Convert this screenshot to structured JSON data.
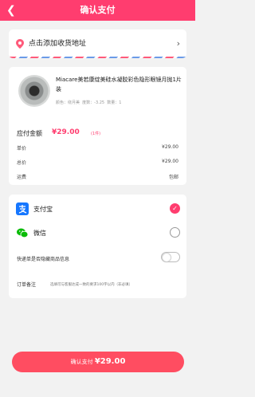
{
  "header": {
    "title": "确认支付",
    "back_glyph": "❮"
  },
  "address": {
    "placeholder_text": "点击添加收货地址",
    "arrow_glyph": "›",
    "pin_color": "#ff5a7a"
  },
  "product": {
    "name": "Miacare美若康绽美硅水凝胶彩色隐形眼镜月抛1片装",
    "spec": "颜色：绕月美  度数：-3.25  数量：1"
  },
  "summary": {
    "due_label": "应付金额",
    "due_price": "¥29.00",
    "due_count": "(1件)",
    "rows": [
      {
        "label": "单价",
        "value": "¥29.00"
      },
      {
        "label": "总价",
        "value": "¥29.00"
      },
      {
        "label": "运费",
        "value": "包邮"
      }
    ]
  },
  "payment": {
    "methods": [
      {
        "label": "支付宝",
        "icon": "alipay-icon",
        "color": "#1677ff",
        "selected": true,
        "check": "✓"
      },
      {
        "label": "微信",
        "icon": "wechat-icon",
        "color": "#09bb07",
        "selected": false
      }
    ],
    "hide_info_label": "快递单是否隐藏商品信息",
    "hide_info_on": false,
    "remark_label": "订单备注",
    "remark_placeholder": "选填可与客服达成一致的要求100字以内（非必填）"
  },
  "button": {
    "prefix": "确认支付",
    "amount": "¥29.00"
  },
  "colors": {
    "accent": "#ff3d6f",
    "button": "#ff4d61"
  }
}
